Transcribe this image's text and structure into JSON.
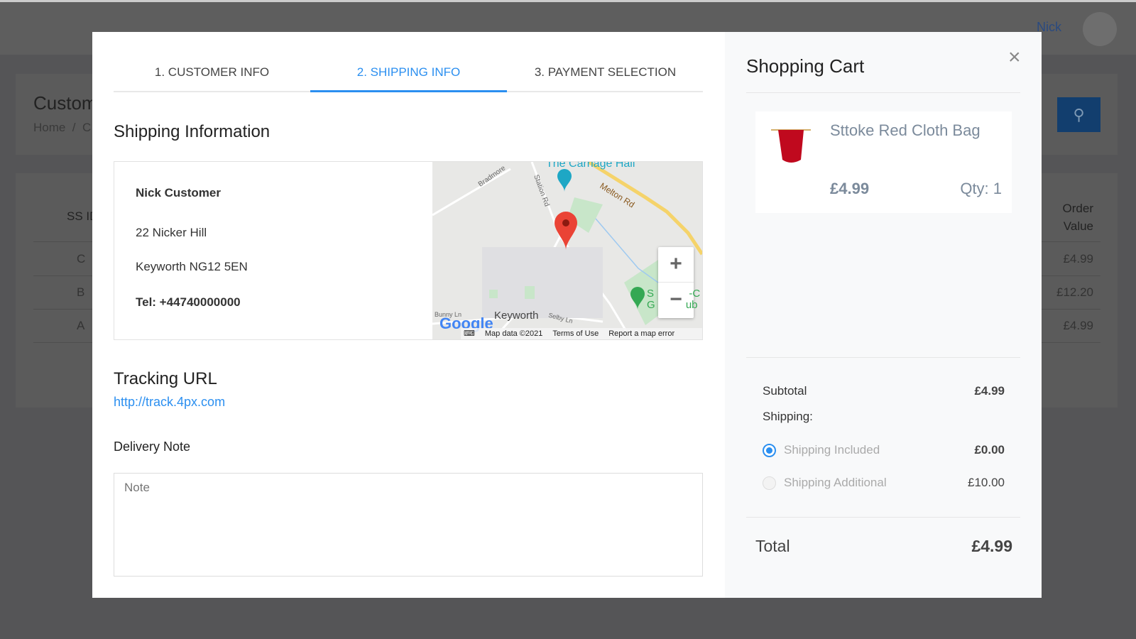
{
  "background": {
    "user_name": "Nick",
    "page_title": "Custom",
    "breadcrumb": "Home  /  C",
    "table": {
      "headers": [
        "SS ID",
        "Order Value"
      ],
      "rows": [
        {
          "id": "C",
          "value": "£4.99"
        },
        {
          "id": "B",
          "value": "£12.20"
        },
        {
          "id": "A",
          "value": "£4.99"
        }
      ]
    }
  },
  "tabs": [
    {
      "label": "1. CUSTOMER INFO"
    },
    {
      "label": "2. SHIPPING INFO",
      "active": true
    },
    {
      "label": "3. PAYMENT SELECTION"
    }
  ],
  "shipping": {
    "heading": "Shipping Information",
    "name": "Nick Customer",
    "address1": "22 Nicker Hill",
    "address2": "Keyworth NG12 5EN",
    "tel": "Tel: +44740000000",
    "map": {
      "labels": {
        "place1": "The Carriage Hall",
        "road1": "Melton Rd",
        "road2": "Station Rd",
        "road3": "Bradmore",
        "town": "Keyworth",
        "road4": "Bunny Ln",
        "road5": "Selby Ln",
        "golf": "S        -C\nG       ub"
      },
      "zoom_in": "+",
      "zoom_out": "−",
      "logo": "Google",
      "map_data": "Map data ©2021",
      "terms": "Terms of Use",
      "report": "Report a map error"
    }
  },
  "tracking": {
    "heading": "Tracking URL",
    "url": "http://track.4px.com"
  },
  "delivery_note": {
    "label": "Delivery Note",
    "placeholder": "Note",
    "value": ""
  },
  "cart": {
    "title": "Shopping Cart",
    "close": "×",
    "item": {
      "name": "Sttoke Red Cloth Bag",
      "price": "£4.99",
      "qty": "Qty: 1"
    },
    "subtotal_label": "Subtotal",
    "subtotal": "£4.99",
    "shipping_label": "Shipping:",
    "options": [
      {
        "label": "Shipping Included",
        "price": "£0.00",
        "selected": true
      },
      {
        "label": "Shipping Additional",
        "price": "£10.00",
        "selected": false
      }
    ],
    "total_label": "Total",
    "total": "£4.99"
  },
  "colors": {
    "accent": "#2b8ff0",
    "overlay": "#555557"
  }
}
